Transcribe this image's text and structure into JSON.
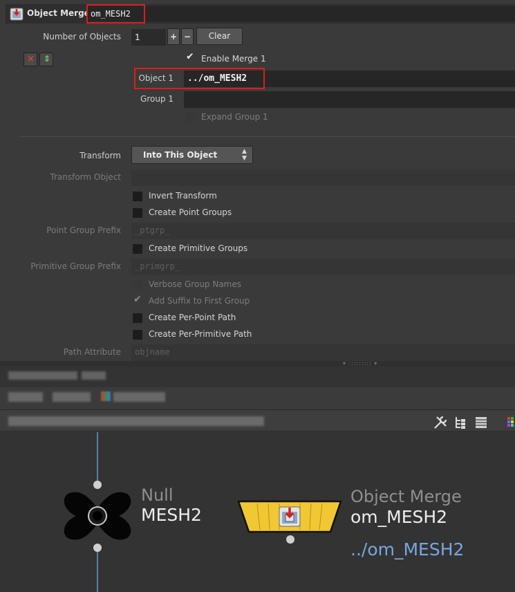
{
  "header": {
    "node_type": "Object Merge",
    "node_name": "om_MESH2"
  },
  "params": {
    "num_objects_label": "Number of Objects",
    "num_objects_value": "1",
    "plus": "+",
    "minus": "−",
    "clear": "Clear",
    "enable_merge_label": "Enable Merge 1",
    "object1_label": "Object 1",
    "object1_value": "../om_MESH2",
    "group1_label": "Group 1",
    "expand_group_label": "Expand Group 1",
    "transform_label": "Transform",
    "transform_value": "Into This Object",
    "transform_object_label": "Transform Object",
    "invert_transform": "Invert Transform",
    "create_point_groups": "Create Point Groups",
    "point_group_prefix_label": "Point Group Prefix",
    "point_group_prefix_placeholder": "_ptgrp_",
    "create_primitive_groups": "Create Primitive Groups",
    "primitive_group_prefix_label": "Primitive Group Prefix",
    "primitive_group_prefix_placeholder": "_primgrp_",
    "verbose_group_names": "Verbose Group Names",
    "add_suffix": "Add Suffix to First Group",
    "create_per_point_path": "Create Per-Point Path",
    "create_per_primitive_path": "Create Per-Primitive Path",
    "path_attribute_label": "Path Attribute",
    "path_attribute_placeholder": "objname"
  },
  "network": {
    "null_node": {
      "type": "Null",
      "name": "MESH2"
    },
    "merge_node": {
      "type": "Object Merge",
      "name": "om_MESH2",
      "path": "../om_MESH2"
    }
  },
  "colors": {
    "accent_red": "#e01c1c",
    "merge_node_yellow": "#f2c734",
    "path_blue": "#79a6e0"
  }
}
